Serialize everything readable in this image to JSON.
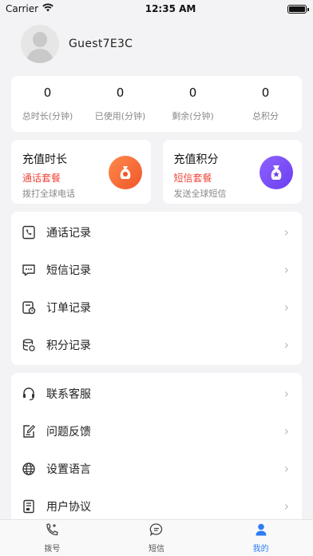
{
  "status_bar": {
    "carrier": "Carrier",
    "time": "12:35 AM"
  },
  "profile": {
    "username": "Guest7E3C"
  },
  "stats": [
    {
      "value": "0",
      "label": "总时长(分钟)"
    },
    {
      "value": "0",
      "label": "已使用(分钟)"
    },
    {
      "value": "0",
      "label": "剩余(分钟)"
    },
    {
      "value": "0",
      "label": "总积分"
    }
  ],
  "recharge": [
    {
      "title": "充值时长",
      "subtitle": "通话套餐",
      "desc": "拨打全球电话",
      "icon": "money-bag-icon"
    },
    {
      "title": "充值积分",
      "subtitle": "短信套餐",
      "desc": "发送全球短信",
      "icon": "points-bag-icon"
    }
  ],
  "menu1": [
    {
      "label": "通话记录",
      "icon": "call-record-icon"
    },
    {
      "label": "短信记录",
      "icon": "sms-record-icon"
    },
    {
      "label": "订单记录",
      "icon": "order-record-icon"
    },
    {
      "label": "积分记录",
      "icon": "points-record-icon"
    }
  ],
  "menu2": [
    {
      "label": "联系客服",
      "icon": "headset-icon"
    },
    {
      "label": "问题反馈",
      "icon": "feedback-icon"
    },
    {
      "label": "设置语言",
      "icon": "globe-icon"
    },
    {
      "label": "用户协议",
      "icon": "document-icon"
    }
  ],
  "tabs": [
    {
      "label": "拨号",
      "icon": "dial-icon"
    },
    {
      "label": "短信",
      "icon": "message-icon"
    },
    {
      "label": "我的",
      "icon": "user-icon"
    }
  ],
  "colors": {
    "accent": "#2b7cf6",
    "highlight": "#f0453a",
    "orange": "#f0552a",
    "purple": "#6a3ef0"
  }
}
